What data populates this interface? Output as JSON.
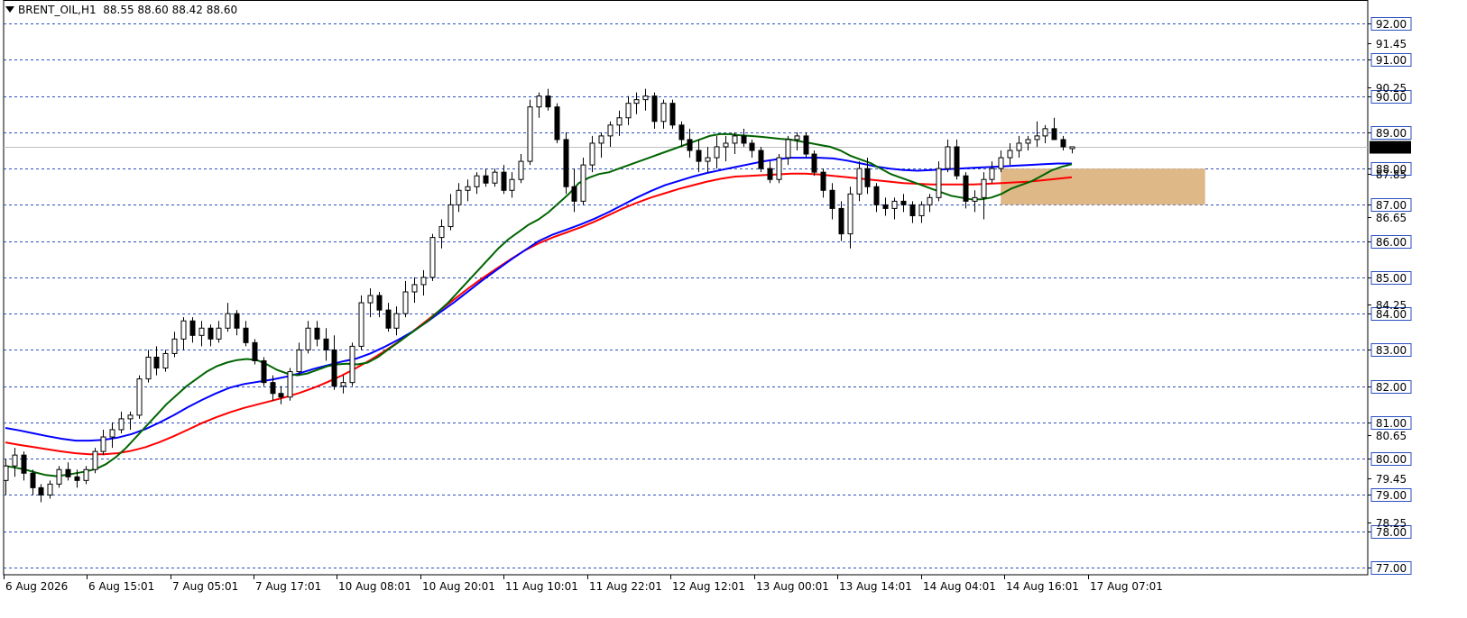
{
  "header": {
    "symbol": "BRENT_OIL,H1",
    "ohlc": "88.55 88.60 88.42 88.60"
  },
  "colors": {
    "grid": "#2a4fbf",
    "bull_body": "#ffffff",
    "bear_body": "#000000",
    "candle_outline": "#000000",
    "ma_fast": "#006400",
    "ma_mid": "#0000ff",
    "ma_slow": "#ff0000",
    "zone": "#deb887",
    "current_price_bg": "#000000",
    "current_price_text": "#ffffff",
    "current_price_line": "#c0c0c0"
  },
  "chart_data": {
    "type": "candlestick",
    "ylim": [
      76.8,
      92.4
    ],
    "y_ticks_boxed": [
      "92.00",
      "91.00",
      "90.00",
      "89.00",
      "88.00",
      "87.00",
      "86.00",
      "85.00",
      "84.00",
      "83.00",
      "82.00",
      "81.00",
      "80.00",
      "79.00",
      "78.00",
      "77.00"
    ],
    "y_ticks_plain": [
      "91.45",
      "90.25",
      "87.85",
      "86.65",
      "84.25",
      "80.65",
      "79.45",
      "78.25"
    ],
    "current_price": "88.60",
    "x_tick_labels": [
      "6 Aug 2026",
      "6 Aug 15:01",
      "7 Aug 05:01",
      "7 Aug 17:01",
      "10 Aug 08:01",
      "10 Aug 20:01",
      "11 Aug 10:01",
      "11 Aug 22:01",
      "12 Aug 12:01",
      "13 Aug 00:01",
      "13 Aug 14:01",
      "14 Aug 04:01",
      "14 Aug 16:01",
      "17 Aug 07:01"
    ],
    "candles": [
      [
        79.4,
        80.0,
        79.0,
        79.8
      ],
      [
        79.8,
        80.3,
        79.5,
        80.1
      ],
      [
        80.1,
        80.2,
        79.4,
        79.6
      ],
      [
        79.6,
        79.7,
        79.0,
        79.2
      ],
      [
        79.2,
        79.3,
        78.8,
        79.0
      ],
      [
        79.0,
        79.4,
        78.9,
        79.3
      ],
      [
        79.3,
        79.8,
        79.2,
        79.7
      ],
      [
        79.7,
        79.9,
        79.4,
        79.5
      ],
      [
        79.5,
        79.7,
        79.2,
        79.4
      ],
      [
        79.4,
        79.8,
        79.3,
        79.7
      ],
      [
        79.7,
        80.3,
        79.6,
        80.2
      ],
      [
        80.2,
        80.8,
        80.1,
        80.6
      ],
      [
        80.6,
        81.0,
        80.3,
        80.8
      ],
      [
        80.8,
        81.3,
        80.7,
        81.1
      ],
      [
        81.1,
        81.3,
        80.8,
        81.2
      ],
      [
        81.2,
        82.3,
        81.1,
        82.2
      ],
      [
        82.2,
        83.0,
        82.1,
        82.8
      ],
      [
        82.8,
        83.1,
        82.3,
        82.5
      ],
      [
        82.5,
        83.0,
        82.4,
        82.9
      ],
      [
        82.9,
        83.5,
        82.8,
        83.3
      ],
      [
        83.3,
        83.9,
        83.0,
        83.8
      ],
      [
        83.8,
        83.9,
        83.2,
        83.4
      ],
      [
        83.4,
        83.8,
        83.1,
        83.6
      ],
      [
        83.6,
        83.7,
        83.1,
        83.3
      ],
      [
        83.3,
        83.8,
        83.2,
        83.6
      ],
      [
        83.6,
        84.3,
        83.5,
        84.0
      ],
      [
        84.0,
        84.1,
        83.4,
        83.6
      ],
      [
        83.6,
        83.8,
        83.1,
        83.2
      ],
      [
        83.2,
        83.3,
        82.6,
        82.7
      ],
      [
        82.7,
        82.8,
        82.0,
        82.1
      ],
      [
        82.1,
        82.3,
        81.6,
        81.8
      ],
      [
        81.8,
        82.0,
        81.5,
        81.7
      ],
      [
        81.7,
        82.5,
        81.6,
        82.4
      ],
      [
        82.4,
        83.2,
        82.3,
        83.0
      ],
      [
        83.0,
        83.8,
        82.9,
        83.6
      ],
      [
        83.6,
        83.8,
        83.1,
        83.3
      ],
      [
        83.3,
        83.6,
        82.7,
        83.0
      ],
      [
        83.0,
        83.4,
        81.9,
        82.0
      ],
      [
        82.0,
        82.3,
        81.8,
        82.1
      ],
      [
        82.1,
        83.2,
        82.0,
        83.1
      ],
      [
        83.1,
        84.5,
        83.0,
        84.3
      ],
      [
        84.3,
        84.7,
        83.9,
        84.5
      ],
      [
        84.5,
        84.6,
        83.9,
        84.1
      ],
      [
        84.1,
        84.3,
        83.5,
        83.6
      ],
      [
        83.6,
        84.2,
        83.4,
        84.0
      ],
      [
        84.0,
        84.9,
        83.9,
        84.6
      ],
      [
        84.6,
        85.0,
        84.3,
        84.8
      ],
      [
        84.8,
        85.2,
        84.5,
        85.0
      ],
      [
        85.0,
        86.2,
        84.9,
        86.1
      ],
      [
        86.1,
        86.6,
        85.8,
        86.4
      ],
      [
        86.4,
        87.3,
        86.3,
        87.0
      ],
      [
        87.0,
        87.6,
        86.8,
        87.4
      ],
      [
        87.4,
        87.7,
        87.1,
        87.5
      ],
      [
        87.5,
        87.9,
        87.3,
        87.8
      ],
      [
        87.8,
        88.0,
        87.5,
        87.6
      ],
      [
        87.6,
        88.0,
        87.5,
        87.9
      ],
      [
        87.9,
        88.1,
        87.3,
        87.4
      ],
      [
        87.4,
        87.9,
        87.2,
        87.7
      ],
      [
        87.7,
        88.4,
        87.6,
        88.2
      ],
      [
        88.2,
        89.9,
        88.1,
        89.7
      ],
      [
        89.7,
        90.1,
        89.4,
        90.0
      ],
      [
        90.0,
        90.2,
        89.6,
        89.7
      ],
      [
        89.7,
        89.8,
        88.7,
        88.8
      ],
      [
        88.8,
        89.0,
        87.3,
        87.5
      ],
      [
        87.5,
        88.0,
        86.8,
        87.1
      ],
      [
        87.1,
        88.3,
        87.0,
        88.1
      ],
      [
        88.1,
        88.9,
        87.9,
        88.7
      ],
      [
        88.7,
        89.0,
        88.3,
        88.9
      ],
      [
        88.9,
        89.3,
        88.6,
        89.2
      ],
      [
        89.2,
        89.6,
        88.9,
        89.4
      ],
      [
        89.4,
        90.0,
        89.2,
        89.8
      ],
      [
        89.8,
        90.1,
        89.5,
        89.9
      ],
      [
        89.9,
        90.2,
        89.6,
        90.0
      ],
      [
        90.0,
        90.1,
        89.1,
        89.3
      ],
      [
        89.3,
        89.9,
        89.1,
        89.8
      ],
      [
        89.8,
        89.9,
        89.1,
        89.2
      ],
      [
        89.2,
        89.3,
        88.6,
        88.8
      ],
      [
        88.8,
        89.1,
        88.3,
        88.5
      ],
      [
        88.5,
        88.8,
        87.9,
        88.2
      ],
      [
        88.2,
        88.6,
        87.9,
        88.3
      ],
      [
        88.3,
        88.9,
        88.0,
        88.6
      ],
      [
        88.6,
        88.9,
        88.2,
        88.7
      ],
      [
        88.7,
        89.0,
        88.4,
        88.9
      ],
      [
        88.9,
        89.1,
        88.6,
        88.7
      ],
      [
        88.7,
        88.8,
        88.3,
        88.5
      ],
      [
        88.5,
        88.6,
        87.9,
        88.0
      ],
      [
        88.0,
        88.2,
        87.6,
        87.7
      ],
      [
        87.7,
        88.4,
        87.6,
        88.3
      ],
      [
        88.3,
        88.9,
        88.1,
        88.8
      ],
      [
        88.8,
        89.0,
        88.5,
        88.9
      ],
      [
        88.9,
        89.0,
        88.3,
        88.4
      ],
      [
        88.4,
        88.5,
        87.8,
        87.9
      ],
      [
        87.9,
        88.0,
        87.2,
        87.4
      ],
      [
        87.4,
        87.6,
        86.6,
        86.9
      ],
      [
        86.9,
        87.1,
        86.0,
        86.2
      ],
      [
        86.2,
        87.5,
        85.8,
        87.3
      ],
      [
        87.3,
        88.2,
        87.1,
        88.0
      ],
      [
        88.0,
        88.3,
        87.3,
        87.5
      ],
      [
        87.5,
        87.6,
        86.8,
        87.0
      ],
      [
        87.0,
        87.2,
        86.7,
        86.9
      ],
      [
        86.9,
        87.2,
        86.6,
        87.1
      ],
      [
        87.1,
        87.3,
        86.8,
        87.0
      ],
      [
        87.0,
        87.1,
        86.5,
        86.7
      ],
      [
        86.7,
        87.1,
        86.5,
        87.0
      ],
      [
        87.0,
        87.3,
        86.8,
        87.2
      ],
      [
        87.2,
        88.2,
        87.1,
        88.0
      ],
      [
        88.0,
        88.8,
        87.9,
        88.6
      ],
      [
        88.6,
        88.8,
        87.7,
        87.8
      ],
      [
        87.8,
        87.9,
        86.9,
        87.1
      ],
      [
        87.1,
        87.4,
        86.8,
        87.2
      ],
      [
        87.2,
        87.9,
        86.6,
        87.7
      ],
      [
        87.7,
        88.2,
        87.6,
        88.0
      ],
      [
        88.0,
        88.5,
        87.9,
        88.3
      ],
      [
        88.3,
        88.7,
        88.1,
        88.5
      ],
      [
        88.5,
        88.9,
        88.3,
        88.7
      ],
      [
        88.7,
        88.9,
        88.5,
        88.8
      ],
      [
        88.8,
        89.3,
        88.6,
        88.9
      ],
      [
        88.9,
        89.2,
        88.7,
        89.1
      ],
      [
        89.1,
        89.4,
        88.8,
        88.8
      ],
      [
        88.8,
        88.9,
        88.5,
        88.6
      ],
      [
        88.55,
        88.6,
        88.42,
        88.6
      ]
    ],
    "ma_fast": [
      79.8,
      79.75,
      79.7,
      79.62,
      79.55,
      79.52,
      79.55,
      79.6,
      79.65,
      79.72,
      79.85,
      80.05,
      80.3,
      80.6,
      80.9,
      81.2,
      81.5,
      81.75,
      82.0,
      82.2,
      82.4,
      82.55,
      82.65,
      82.72,
      82.75,
      82.72,
      82.6,
      82.45,
      82.35,
      82.3,
      82.35,
      82.45,
      82.55,
      82.6,
      82.62,
      82.6,
      82.65,
      82.8,
      83.0,
      83.2,
      83.4,
      83.6,
      83.8,
      84.05,
      84.3,
      84.6,
      84.9,
      85.2,
      85.5,
      85.8,
      86.05,
      86.25,
      86.45,
      86.6,
      86.8,
      87.05,
      87.3,
      87.6,
      87.75,
      87.85,
      87.9,
      88.0,
      88.1,
      88.2,
      88.3,
      88.4,
      88.5,
      88.6,
      88.7,
      88.8,
      88.9,
      88.95,
      88.95,
      88.92,
      88.9,
      88.88,
      88.85,
      88.82,
      88.8,
      88.75,
      88.7,
      88.65,
      88.6,
      88.5,
      88.35,
      88.25,
      88.15,
      88.0,
      87.85,
      87.75,
      87.65,
      87.55,
      87.45,
      87.35,
      87.25,
      87.2,
      87.15,
      87.15,
      87.2,
      87.3,
      87.45,
      87.55,
      87.65,
      87.8,
      87.95,
      88.05,
      88.12
    ],
    "ma_mid": [
      80.85,
      80.78,
      80.7,
      80.62,
      80.55,
      80.5,
      80.5,
      80.52,
      80.58,
      80.68,
      80.82,
      81.0,
      81.2,
      81.42,
      81.62,
      81.8,
      81.96,
      82.06,
      82.12,
      82.18,
      82.26,
      82.36,
      82.48,
      82.58,
      82.68,
      82.76,
      82.9,
      83.08,
      83.28,
      83.5,
      83.76,
      84.04,
      84.32,
      84.62,
      84.92,
      85.2,
      85.48,
      85.74,
      86.0,
      86.18,
      86.32,
      86.46,
      86.62,
      86.8,
      87.0,
      87.2,
      87.38,
      87.54,
      87.66,
      87.78,
      87.88,
      87.96,
      88.04,
      88.12,
      88.2,
      88.26,
      88.3,
      88.3,
      88.3,
      88.28,
      88.22,
      88.14,
      88.06,
      88.0,
      87.96,
      87.94,
      87.96,
      87.98,
      88.0,
      88.02,
      88.04,
      88.06,
      88.08,
      88.1,
      88.12,
      88.14,
      88.14
    ],
    "ma_slow": [
      80.45,
      80.38,
      80.32,
      80.26,
      80.2,
      80.15,
      80.12,
      80.12,
      80.15,
      80.22,
      80.32,
      80.46,
      80.62,
      80.8,
      80.98,
      81.14,
      81.28,
      81.4,
      81.5,
      81.6,
      81.7,
      81.82,
      81.96,
      82.12,
      82.3,
      82.5,
      82.72,
      82.96,
      83.22,
      83.5,
      83.8,
      84.1,
      84.4,
      84.7,
      84.98,
      85.24,
      85.5,
      85.74,
      85.94,
      86.1,
      86.24,
      86.38,
      86.54,
      86.72,
      86.9,
      87.06,
      87.2,
      87.32,
      87.44,
      87.54,
      87.64,
      87.72,
      87.78,
      87.8,
      87.82,
      87.84,
      87.86,
      87.86,
      87.84,
      87.8,
      87.76,
      87.72,
      87.68,
      87.64,
      87.6,
      87.58,
      87.56,
      87.56,
      87.56,
      87.56,
      87.58,
      87.6,
      87.62,
      87.64,
      87.68,
      87.72,
      87.76
    ],
    "zone": {
      "y1": 88.0,
      "y2": 87.0,
      "start_index": 112,
      "end_index": 135
    }
  }
}
